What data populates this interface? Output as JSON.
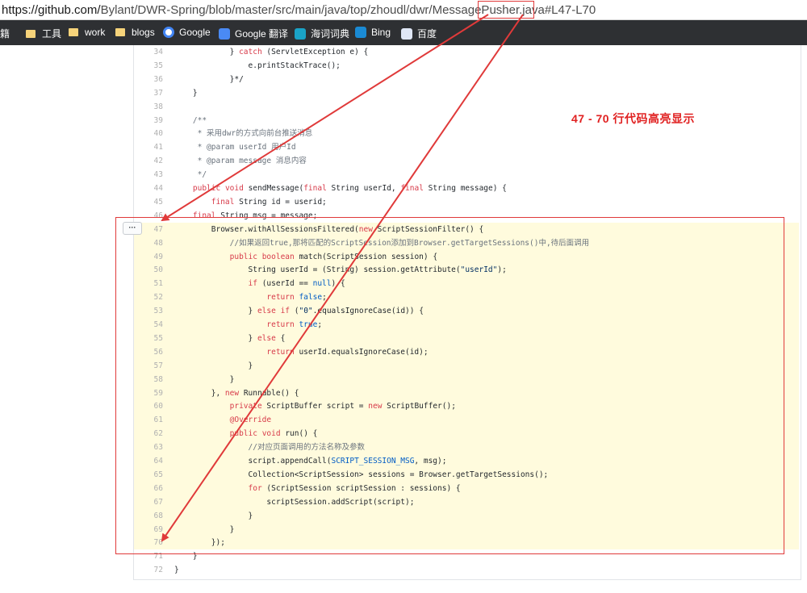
{
  "browser": {
    "url_host": "https://github.com/",
    "url_path": "Bylant/DWR-Spring/blob/master/src/main/java/top/zhoudl/dwr/MessagePusher.java",
    "url_fragment": "#L47-L70"
  },
  "bookmarks": [
    {
      "label": "书籍",
      "icon": "folder-icon"
    },
    {
      "label": "工具",
      "icon": "folder-icon"
    },
    {
      "label": "work",
      "icon": "folder-icon"
    },
    {
      "label": "blogs",
      "icon": "folder-icon"
    },
    {
      "label": "Google",
      "icon": "google-icon"
    },
    {
      "label": "Google 翻译",
      "icon": "google-translate-icon"
    },
    {
      "label": "海词词典",
      "icon": "dict-icon"
    },
    {
      "label": "Bing",
      "icon": "bing-icon"
    },
    {
      "label": "百度",
      "icon": "baidu-icon"
    }
  ],
  "annotation": "47 - 70 行代码高亮显示",
  "more_button": "···",
  "highlight": {
    "from": 47,
    "to": 70
  },
  "lines": [
    {
      "n": "34",
      "code": "            } catch (ServletException e) {"
    },
    {
      "n": "35",
      "code": "                e.printStackTrace();"
    },
    {
      "n": "36",
      "code": "            }*/"
    },
    {
      "n": "37",
      "code": "    }"
    },
    {
      "n": "38",
      "code": ""
    },
    {
      "n": "39",
      "code": "    /**"
    },
    {
      "n": "40",
      "code": "     * 采用dwr的方式向前台推送消息"
    },
    {
      "n": "41",
      "code": "     * @param userId 用户Id"
    },
    {
      "n": "42",
      "code": "     * @param message 消息内容"
    },
    {
      "n": "43",
      "code": "     */"
    },
    {
      "n": "44",
      "code": "    public void sendMessage(final String userId, final String message) {"
    },
    {
      "n": "45",
      "code": "        final String id = userid;"
    },
    {
      "n": "46",
      "code": "    final String msg = message;"
    },
    {
      "n": "47",
      "code": "        Browser.withAllSessionsFiltered(new ScriptSessionFilter() {"
    },
    {
      "n": "48",
      "code": "            //如果返回true,那将匹配的ScriptSession添加到Browser.getTargetSessions()中,待后面调用"
    },
    {
      "n": "49",
      "code": "            public boolean match(ScriptSession session) {"
    },
    {
      "n": "50",
      "code": "                String userId = (String) session.getAttribute(\"userId\");"
    },
    {
      "n": "51",
      "code": "                if (userId == null) {"
    },
    {
      "n": "52",
      "code": "                    return false;"
    },
    {
      "n": "53",
      "code": "                } else if (\"0\".equalsIgnoreCase(id)) {"
    },
    {
      "n": "54",
      "code": "                    return true;"
    },
    {
      "n": "55",
      "code": "                } else {"
    },
    {
      "n": "56",
      "code": "                    return userId.equalsIgnoreCase(id);"
    },
    {
      "n": "57",
      "code": "                }"
    },
    {
      "n": "58",
      "code": "            }"
    },
    {
      "n": "59",
      "code": "        }, new Runnable() {"
    },
    {
      "n": "60",
      "code": "            private ScriptBuffer script = new ScriptBuffer();"
    },
    {
      "n": "61",
      "code": "            @Override"
    },
    {
      "n": "62",
      "code": "            public void run() {"
    },
    {
      "n": "63",
      "code": "                //对应页面调用的方法名称及参数"
    },
    {
      "n": "64",
      "code": "                script.appendCall(SCRIPT_SESSION_MSG, msg);"
    },
    {
      "n": "65",
      "code": "                Collection<ScriptSession> sessions = Browser.getTargetSessions();"
    },
    {
      "n": "66",
      "code": "                for (ScriptSession scriptSession : sessions) {"
    },
    {
      "n": "67",
      "code": "                    scriptSession.addScript(script);"
    },
    {
      "n": "68",
      "code": "                }"
    },
    {
      "n": "69",
      "code": "            }"
    },
    {
      "n": "70",
      "code": "        });"
    },
    {
      "n": "71",
      "code": "    }"
    },
    {
      "n": "72",
      "code": "}"
    }
  ],
  "colors": {
    "annotation": "#e02020",
    "highlight_bg": "#fffbdd",
    "arrow": "#e03a3a"
  }
}
